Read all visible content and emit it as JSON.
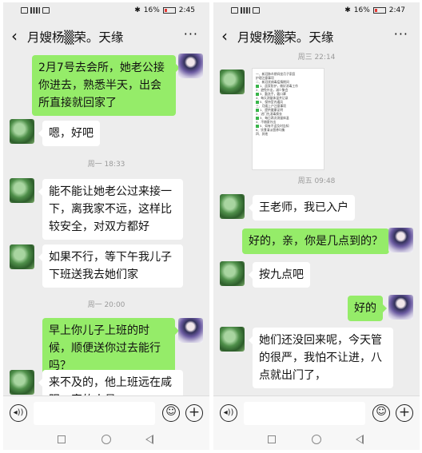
{
  "screens": [
    {
      "status": {
        "icons_left": "HD 4G signal wifi",
        "battery": "16%",
        "time": "2:45"
      },
      "header": {
        "back_icon": "‹",
        "title": "月嫂杨▒荣。天缘",
        "more_icon": "···"
      },
      "messages": [
        {
          "side": "right",
          "text": "2月7号去会所，她老公接你进去，熟悉半天，出会所直接就回家了"
        },
        {
          "side": "left",
          "text": "嗯，好吧"
        },
        {
          "type": "time",
          "text": "周一 18:33"
        },
        {
          "side": "left",
          "text": "能不能让她老公过来接一下，离我家不远，这样比较安全，对双方都好"
        },
        {
          "side": "left",
          "text": "如果不行，等下午我儿子下班送我去她们家"
        },
        {
          "type": "time",
          "text": "周一 20:00"
        },
        {
          "side": "right",
          "text": "早上你儿子上班的时候，顺便送你过去能行吗？"
        },
        {
          "side": "left",
          "text": "来不及的，他上班远在咸阳，家的人员"
        }
      ]
    },
    {
      "status": {
        "icons_left": "HD 4G signal wifi",
        "battery": "16%",
        "time": "2:47"
      },
      "header": {
        "back_icon": "‹",
        "title": "月嫂杨▒荣。天缘",
        "more_icon": "···"
      },
      "messages": [
        {
          "type": "time",
          "text": "周三 22:14"
        },
        {
          "side": "left",
          "type": "image",
          "lines": [
            "一、新冠肺炎期间坐月子家庭",
            "护理注意事项",
            "二、新冠状病毒疫情期间",
            "1、居家防护，做好消毒工作",
            "2、避免外出，减少聚会",
            "3、勤洗手，戴口罩",
            "4、每天测量体温并记录",
            "5、保持室内通风",
            "三、月嫂上户注意事项",
            "1、提供健康证明",
            "2、进门先消毒换衣",
            "3、每日两次测量体温",
            "4、不随意外出",
            "5、如有不适及时告知",
            "6、饮食清淡营养均衡",
            "四、其他"
          ]
        },
        {
          "type": "time",
          "text": "周五 09:48"
        },
        {
          "side": "left",
          "text": "王老师，我已入户"
        },
        {
          "side": "right",
          "text": "好的，亲，你是几点到的？"
        },
        {
          "side": "left",
          "text": "按九点吧"
        },
        {
          "side": "right",
          "text": "好的"
        },
        {
          "side": "left",
          "text": "她们还没回来呢，今天管的很严，我怕不让进，八点就出门了，"
        }
      ]
    }
  ],
  "input": {
    "voice_icon": "voice-icon",
    "emoji_icon": "emoji-icon",
    "plus_icon": "plus-icon"
  },
  "colors": {
    "background": "#ededed",
    "sent_bubble": "#95ec69",
    "received_bubble": "#ffffff"
  }
}
